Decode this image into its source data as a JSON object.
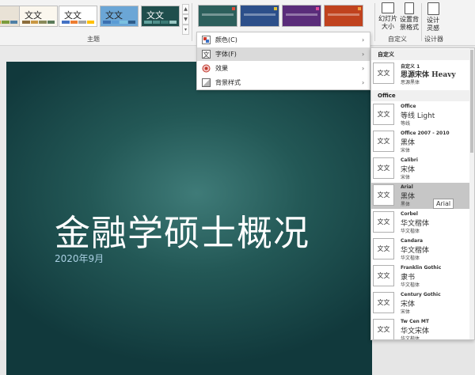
{
  "ribbon": {
    "themes_group_label": "主题",
    "themes": [
      {
        "text": "",
        "bg": "#e9e2d6",
        "bars": [
          "#c8502c",
          "#e0a23a",
          "#7b9c3b",
          "#4e7fa6"
        ]
      },
      {
        "text": "文文",
        "bg": "#fbf7ee",
        "bars": [
          "#8c6d3b",
          "#c99743",
          "#8a8a5a",
          "#5b7a5a"
        ]
      },
      {
        "text": "文文",
        "bg": "#ffffff",
        "bars": [
          "#4472c4",
          "#ed7d31",
          "#a5a5a5",
          "#ffc000"
        ]
      },
      {
        "text": "文文",
        "bg": "#6ba6d6",
        "bars": [
          "#3b6fb0",
          "#5a9bd5",
          "#7ac0e0",
          "#2e5c8a"
        ]
      },
      {
        "text": "文文",
        "bg": "#1f4e4c",
        "bars": [
          "#62a39f",
          "#4f8f8b",
          "#3c7a76",
          "#9ac7c3"
        ]
      }
    ],
    "variants": [
      {
        "bg": "#2c5f5c",
        "flag": "#e04a3a"
      },
      {
        "bg": "#2c4f8a",
        "flag": "#e0c23a"
      },
      {
        "bg": "#5a2c7a",
        "flag": "#e04a9a"
      },
      {
        "bg": "#c0421e",
        "flag": "#f0a040"
      }
    ],
    "custom": {
      "slide_size_label": "幻灯片\n大小",
      "format_bg_label": "设置背\n景格式",
      "group_label": "自定义"
    },
    "designer": {
      "label": "设计\n灵感",
      "group_label": "设计器"
    }
  },
  "menu": {
    "items": [
      {
        "label": "颜色(C)",
        "icon": "color-palette-icon"
      },
      {
        "label": "字体(F)",
        "icon": "font-icon",
        "active": true
      },
      {
        "label": "效果",
        "icon": "effects-icon"
      },
      {
        "label": "背景样式",
        "icon": "background-icon"
      }
    ]
  },
  "flyout": {
    "custom_header": "自定义",
    "custom_item": {
      "icon_text": "文文",
      "name": "自定义 1",
      "heading": "思源宋体 Heavy",
      "body": "思源黑体"
    },
    "office_header": "Office",
    "fonts": [
      {
        "icon_text": "文文",
        "name": "Office",
        "heading": "等线 Light",
        "body": "等线"
      },
      {
        "icon_text": "文文",
        "name": "Office 2007 - 2010",
        "heading": "黑体",
        "body": "宋体"
      },
      {
        "icon_text": "文文",
        "name": "Calibri",
        "heading": "宋体",
        "body": "宋体"
      },
      {
        "icon_text": "文文",
        "name": "Arial",
        "heading": "黑体",
        "body": "黑体",
        "hover": true
      },
      {
        "icon_text": "文文",
        "name": "Corbel",
        "heading": "华文楷体",
        "body": "华文楷体"
      },
      {
        "icon_text": "文文",
        "name": "Candara",
        "heading": "华文楷体",
        "body": "华文楷体"
      },
      {
        "icon_text": "文文",
        "name": "Franklin Gothic",
        "heading": "隶书",
        "body": "华文楷体"
      },
      {
        "icon_text": "文文",
        "name": "Century Gothic",
        "heading": "宋体",
        "body": "宋体"
      },
      {
        "icon_text": "文文",
        "name": "Tw Cen MT",
        "heading": "华文宋体",
        "body": "华文楷体"
      }
    ],
    "tooltip": "Arial"
  },
  "slide": {
    "title": "金融学硕士概况",
    "date": "2020年9月"
  }
}
